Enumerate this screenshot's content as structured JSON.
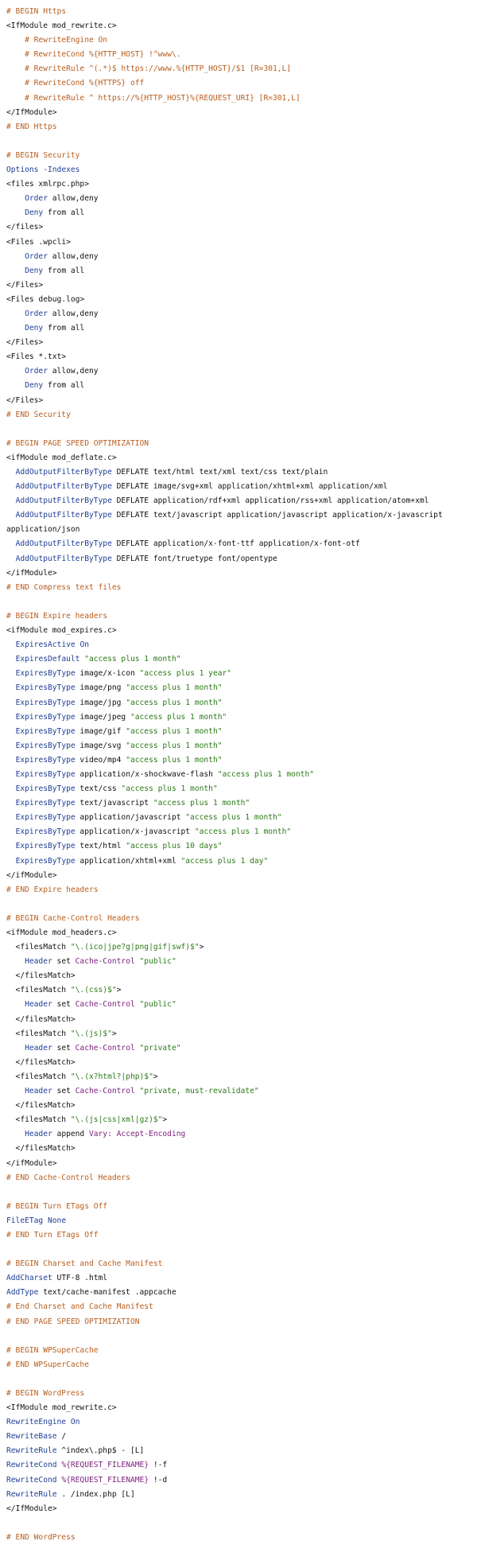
{
  "lines": [
    [
      [
        "c",
        "# BEGIN Https"
      ]
    ],
    [
      [
        "t",
        "<IfModule mod_rewrite.c>"
      ]
    ],
    [
      [
        "c",
        "    # RewriteEngine On"
      ]
    ],
    [
      [
        "c",
        "    # RewriteCond %{HTTP_HOST} !^www\\."
      ]
    ],
    [
      [
        "c",
        "    # RewriteRule ^(.*)$ https://www.%{HTTP_HOST}/$1 [R=301,L]"
      ]
    ],
    [
      [
        "c",
        "    # RewriteCond %{HTTPS} off"
      ]
    ],
    [
      [
        "c",
        "    # RewriteRule ^ https://%{HTTP_HOST}%{REQUEST_URI} [R=301,L]"
      ]
    ],
    [
      [
        "t",
        "</IfModule>"
      ]
    ],
    [
      [
        "c",
        "# END Https"
      ]
    ],
    [],
    [
      [
        "c",
        "# BEGIN Security"
      ]
    ],
    [
      [
        "k",
        "Options"
      ],
      [
        "t",
        " "
      ],
      [
        "k",
        "-Indexes"
      ]
    ],
    [
      [
        "t",
        "<files xmlrpc.php>"
      ]
    ],
    [
      [
        "t",
        "    "
      ],
      [
        "k",
        "Order"
      ],
      [
        "t",
        " allow,deny"
      ]
    ],
    [
      [
        "t",
        "    "
      ],
      [
        "k",
        "Deny"
      ],
      [
        "t",
        " from all"
      ]
    ],
    [
      [
        "t",
        "</files>"
      ]
    ],
    [
      [
        "t",
        "<Files .wpcli>"
      ]
    ],
    [
      [
        "t",
        "    "
      ],
      [
        "k",
        "Order"
      ],
      [
        "t",
        " allow,deny"
      ]
    ],
    [
      [
        "t",
        "    "
      ],
      [
        "k",
        "Deny"
      ],
      [
        "t",
        " from all"
      ]
    ],
    [
      [
        "t",
        "</Files>"
      ]
    ],
    [
      [
        "t",
        "<Files debug.log>"
      ]
    ],
    [
      [
        "t",
        "    "
      ],
      [
        "k",
        "Order"
      ],
      [
        "t",
        " allow,deny"
      ]
    ],
    [
      [
        "t",
        "    "
      ],
      [
        "k",
        "Deny"
      ],
      [
        "t",
        " from all"
      ]
    ],
    [
      [
        "t",
        "</Files>"
      ]
    ],
    [
      [
        "t",
        "<Files *.txt>"
      ]
    ],
    [
      [
        "t",
        "    "
      ],
      [
        "k",
        "Order"
      ],
      [
        "t",
        " allow,deny"
      ]
    ],
    [
      [
        "t",
        "    "
      ],
      [
        "k",
        "Deny"
      ],
      [
        "t",
        " from all"
      ]
    ],
    [
      [
        "t",
        "</Files>"
      ]
    ],
    [
      [
        "c",
        "# END Security"
      ]
    ],
    [],
    [
      [
        "c",
        "# BEGIN PAGE SPEED OPTIMIZATION"
      ]
    ],
    [
      [
        "t",
        "<ifModule mod_deflate.c>"
      ]
    ],
    [
      [
        "t",
        "  "
      ],
      [
        "k",
        "AddOutputFilterByType"
      ],
      [
        "t",
        " DEFLATE text/html text/xml text/css text/plain"
      ]
    ],
    [
      [
        "t",
        "  "
      ],
      [
        "k",
        "AddOutputFilterByType"
      ],
      [
        "t",
        " DEFLATE image/svg+xml application/xhtml+xml application/xml"
      ]
    ],
    [
      [
        "t",
        "  "
      ],
      [
        "k",
        "AddOutputFilterByType"
      ],
      [
        "t",
        " DEFLATE application/rdf+xml application/rss+xml application/atom+xml"
      ]
    ],
    [
      [
        "t",
        "  "
      ],
      [
        "k",
        "AddOutputFilterByType"
      ],
      [
        "t",
        " DEFLATE text/javascript application/javascript application/x-javascript"
      ]
    ],
    [
      [
        "t",
        "application/json"
      ]
    ],
    [
      [
        "t",
        "  "
      ],
      [
        "k",
        "AddOutputFilterByType"
      ],
      [
        "t",
        " DEFLATE application/x-font-ttf application/x-font-otf"
      ]
    ],
    [
      [
        "t",
        "  "
      ],
      [
        "k",
        "AddOutputFilterByType"
      ],
      [
        "t",
        " DEFLATE font/truetype font/opentype"
      ]
    ],
    [
      [
        "t",
        "</ifModule>"
      ]
    ],
    [
      [
        "c",
        "# END Compress text files"
      ]
    ],
    [],
    [
      [
        "c",
        "# BEGIN Expire headers"
      ]
    ],
    [
      [
        "t",
        "<ifModule mod_expires.c>"
      ]
    ],
    [
      [
        "t",
        "  "
      ],
      [
        "k",
        "ExpiresActive"
      ],
      [
        "t",
        " "
      ],
      [
        "k",
        "On"
      ]
    ],
    [
      [
        "t",
        "  "
      ],
      [
        "k",
        "ExpiresDefault"
      ],
      [
        "t",
        " "
      ],
      [
        "s",
        "\"access plus 1 month\""
      ]
    ],
    [
      [
        "t",
        "  "
      ],
      [
        "k",
        "ExpiresByType"
      ],
      [
        "t",
        " image/x-icon "
      ],
      [
        "s",
        "\"access plus 1 year\""
      ]
    ],
    [
      [
        "t",
        "  "
      ],
      [
        "k",
        "ExpiresByType"
      ],
      [
        "t",
        " image/png "
      ],
      [
        "s",
        "\"access plus 1 month\""
      ]
    ],
    [
      [
        "t",
        "  "
      ],
      [
        "k",
        "ExpiresByType"
      ],
      [
        "t",
        " image/jpg "
      ],
      [
        "s",
        "\"access plus 1 month\""
      ]
    ],
    [
      [
        "t",
        "  "
      ],
      [
        "k",
        "ExpiresByType"
      ],
      [
        "t",
        " image/jpeg "
      ],
      [
        "s",
        "\"access plus 1 month\""
      ]
    ],
    [
      [
        "t",
        "  "
      ],
      [
        "k",
        "ExpiresByType"
      ],
      [
        "t",
        " image/gif "
      ],
      [
        "s",
        "\"access plus 1 month\""
      ]
    ],
    [
      [
        "t",
        "  "
      ],
      [
        "k",
        "ExpiresByType"
      ],
      [
        "t",
        " image/svg "
      ],
      [
        "s",
        "\"access plus 1 month\""
      ]
    ],
    [
      [
        "t",
        "  "
      ],
      [
        "k",
        "ExpiresByType"
      ],
      [
        "t",
        " video/mp4 "
      ],
      [
        "s",
        "\"access plus 1 month\""
      ]
    ],
    [
      [
        "t",
        "  "
      ],
      [
        "k",
        "ExpiresByType"
      ],
      [
        "t",
        " application/x-shockwave-flash "
      ],
      [
        "s",
        "\"access plus 1 month\""
      ]
    ],
    [
      [
        "t",
        "  "
      ],
      [
        "k",
        "ExpiresByType"
      ],
      [
        "t",
        " text/css "
      ],
      [
        "s",
        "\"access plus 1 month\""
      ]
    ],
    [
      [
        "t",
        "  "
      ],
      [
        "k",
        "ExpiresByType"
      ],
      [
        "t",
        " text/javascript "
      ],
      [
        "s",
        "\"access plus 1 month\""
      ]
    ],
    [
      [
        "t",
        "  "
      ],
      [
        "k",
        "ExpiresByType"
      ],
      [
        "t",
        " application/javascript "
      ],
      [
        "s",
        "\"access plus 1 month\""
      ]
    ],
    [
      [
        "t",
        "  "
      ],
      [
        "k",
        "ExpiresByType"
      ],
      [
        "t",
        " application/x-javascript "
      ],
      [
        "s",
        "\"access plus 1 month\""
      ]
    ],
    [
      [
        "t",
        "  "
      ],
      [
        "k",
        "ExpiresByType"
      ],
      [
        "t",
        " text/html "
      ],
      [
        "s",
        "\"access plus 10 days\""
      ]
    ],
    [
      [
        "t",
        "  "
      ],
      [
        "k",
        "ExpiresByType"
      ],
      [
        "t",
        " application/xhtml+xml "
      ],
      [
        "s",
        "\"access plus 1 day\""
      ]
    ],
    [
      [
        "t",
        "</ifModule>"
      ]
    ],
    [
      [
        "c",
        "# END Expire headers"
      ]
    ],
    [],
    [
      [
        "c",
        "# BEGIN Cache-Control Headers"
      ]
    ],
    [
      [
        "t",
        "<ifModule mod_headers.c>"
      ]
    ],
    [
      [
        "t",
        "  <filesMatch "
      ],
      [
        "s",
        "\"\\.(ico|jpe?g|png|gif|swf)$\""
      ],
      [
        "t",
        ">"
      ]
    ],
    [
      [
        "t",
        "    "
      ],
      [
        "k",
        "Header"
      ],
      [
        "t",
        " set "
      ],
      [
        "e",
        "Cache-Control"
      ],
      [
        "t",
        " "
      ],
      [
        "s",
        "\"public\""
      ]
    ],
    [
      [
        "t",
        "  </filesMatch>"
      ]
    ],
    [
      [
        "t",
        "  <filesMatch "
      ],
      [
        "s",
        "\"\\.(css)$\""
      ],
      [
        "t",
        ">"
      ]
    ],
    [
      [
        "t",
        "    "
      ],
      [
        "k",
        "Header"
      ],
      [
        "t",
        " set "
      ],
      [
        "e",
        "Cache-Control"
      ],
      [
        "t",
        " "
      ],
      [
        "s",
        "\"public\""
      ]
    ],
    [
      [
        "t",
        "  </filesMatch>"
      ]
    ],
    [
      [
        "t",
        "  <filesMatch "
      ],
      [
        "s",
        "\"\\.(js)$\""
      ],
      [
        "t",
        ">"
      ]
    ],
    [
      [
        "t",
        "    "
      ],
      [
        "k",
        "Header"
      ],
      [
        "t",
        " set "
      ],
      [
        "e",
        "Cache-Control"
      ],
      [
        "t",
        " "
      ],
      [
        "s",
        "\"private\""
      ]
    ],
    [
      [
        "t",
        "  </filesMatch>"
      ]
    ],
    [
      [
        "t",
        "  <filesMatch "
      ],
      [
        "s",
        "\"\\.(x?html?|php)$\""
      ],
      [
        "t",
        ">"
      ]
    ],
    [
      [
        "t",
        "    "
      ],
      [
        "k",
        "Header"
      ],
      [
        "t",
        " set "
      ],
      [
        "e",
        "Cache-Control"
      ],
      [
        "t",
        " "
      ],
      [
        "s",
        "\"private, must-revalidate\""
      ]
    ],
    [
      [
        "t",
        "  </filesMatch>"
      ]
    ],
    [
      [
        "t",
        "  <filesMatch "
      ],
      [
        "s",
        "\"\\.(js|css|xml|gz)$\""
      ],
      [
        "t",
        ">"
      ]
    ],
    [
      [
        "t",
        "    "
      ],
      [
        "k",
        "Header"
      ],
      [
        "t",
        " append "
      ],
      [
        "e",
        "Vary: Accept-Encoding"
      ]
    ],
    [
      [
        "t",
        "  </filesMatch>"
      ]
    ],
    [
      [
        "t",
        "</ifModule>"
      ]
    ],
    [
      [
        "c",
        "# END Cache-Control Headers"
      ]
    ],
    [],
    [
      [
        "c",
        "# BEGIN Turn ETags Off"
      ]
    ],
    [
      [
        "k",
        "FileETag"
      ],
      [
        "t",
        " "
      ],
      [
        "k",
        "None"
      ]
    ],
    [
      [
        "c",
        "# END Turn ETags Off"
      ]
    ],
    [],
    [
      [
        "c",
        "# BEGIN Charset and Cache Manifest"
      ]
    ],
    [
      [
        "k",
        "AddCharset"
      ],
      [
        "t",
        " UTF-8 .html"
      ]
    ],
    [
      [
        "k",
        "AddType"
      ],
      [
        "t",
        " text/cache-manifest .appcache"
      ]
    ],
    [
      [
        "c",
        "# End Charset and Cache Manifest"
      ]
    ],
    [
      [
        "c",
        "# END PAGE SPEED OPTIMIZATION"
      ]
    ],
    [],
    [
      [
        "c",
        "# BEGIN WPSuperCache"
      ]
    ],
    [
      [
        "c",
        "# END WPSuperCache"
      ]
    ],
    [],
    [
      [
        "c",
        "# BEGIN WordPress"
      ]
    ],
    [
      [
        "t",
        "<IfModule mod_rewrite.c>"
      ]
    ],
    [
      [
        "k",
        "RewriteEngine"
      ],
      [
        "t",
        " "
      ],
      [
        "k",
        "On"
      ]
    ],
    [
      [
        "k",
        "RewriteBase"
      ],
      [
        "t",
        " /"
      ]
    ],
    [
      [
        "k",
        "RewriteRule"
      ],
      [
        "t",
        " ^index\\.php$ - [L]"
      ]
    ],
    [
      [
        "k",
        "RewriteCond"
      ],
      [
        "t",
        " "
      ],
      [
        "e",
        "%{REQUEST_FILENAME}"
      ],
      [
        "t",
        " !-f"
      ]
    ],
    [
      [
        "k",
        "RewriteCond"
      ],
      [
        "t",
        " "
      ],
      [
        "e",
        "%{REQUEST_FILENAME}"
      ],
      [
        "t",
        " !-d"
      ]
    ],
    [
      [
        "k",
        "RewriteRule"
      ],
      [
        "t",
        " . /index.php [L]"
      ]
    ],
    [
      [
        "t",
        "</IfModule>"
      ]
    ],
    [],
    [
      [
        "c",
        "# END WordPress"
      ]
    ]
  ]
}
